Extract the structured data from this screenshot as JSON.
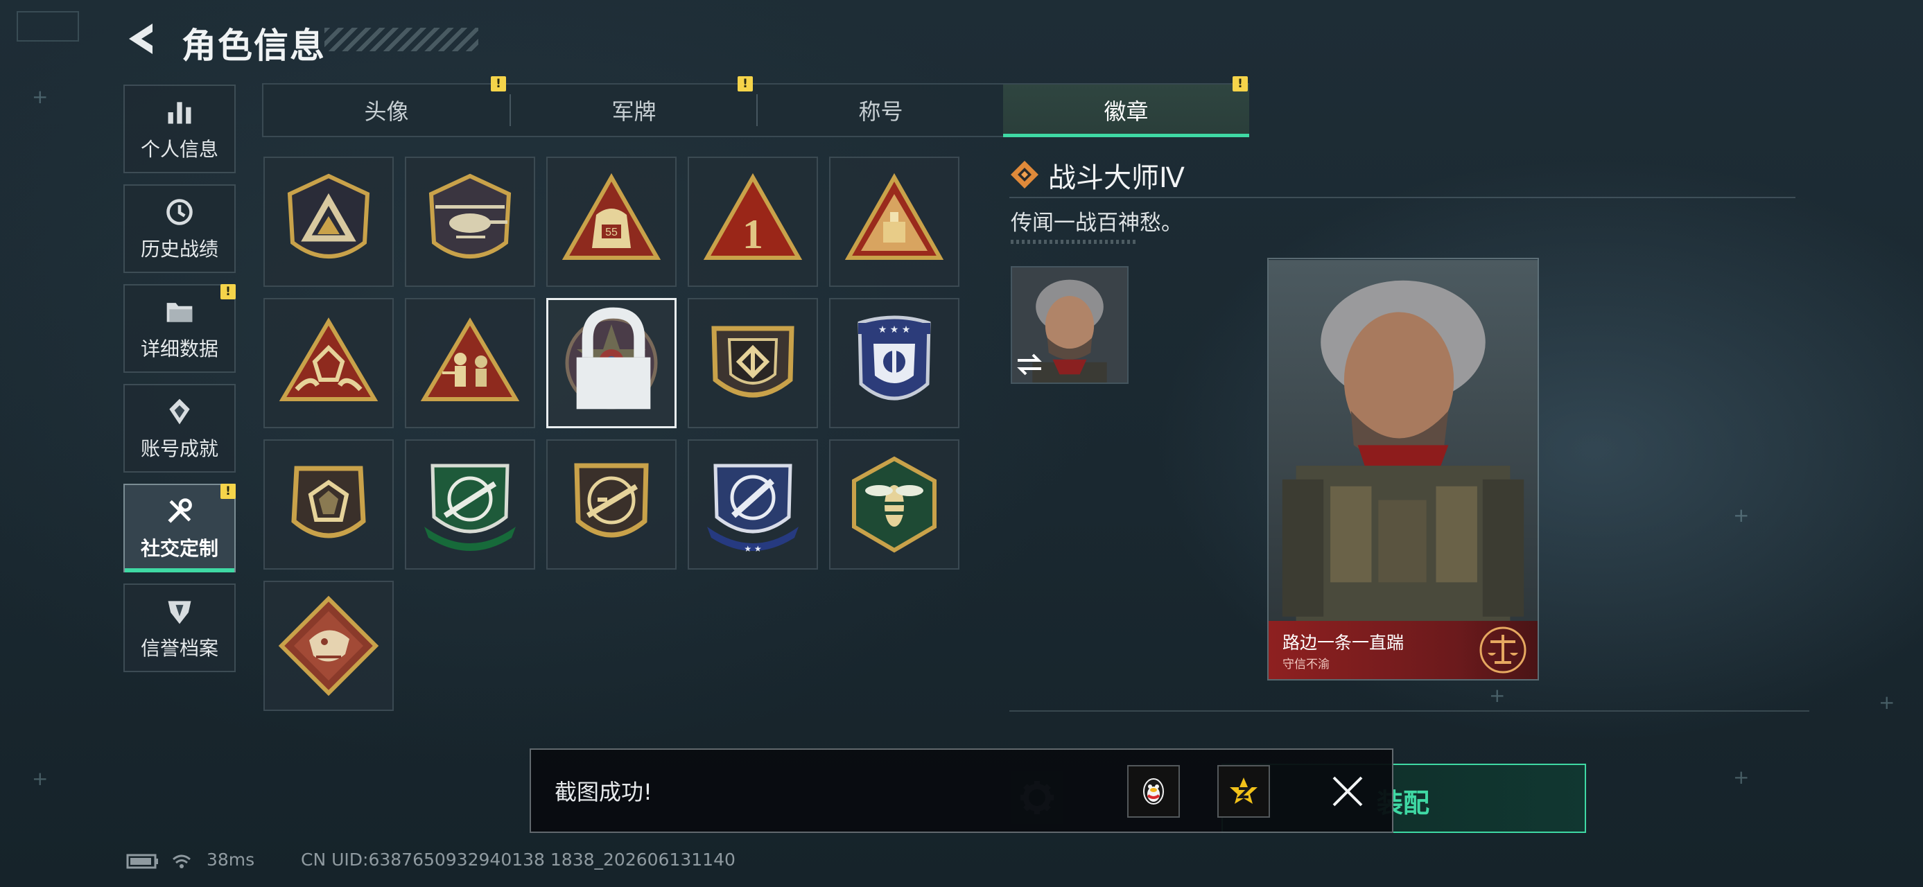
{
  "header": {
    "title": "角色信息"
  },
  "nav": {
    "items": [
      {
        "label": "个人信息",
        "icon": "bar-chart-icon"
      },
      {
        "label": "历史战绩",
        "icon": "history-clock-icon"
      },
      {
        "label": "详细数据",
        "icon": "folder-icon",
        "alert": "!"
      },
      {
        "label": "账号成就",
        "icon": "achievement-icon"
      },
      {
        "label": "社交定制",
        "icon": "wrench-screwdriver-icon",
        "alert": "!",
        "active": true
      },
      {
        "label": "信誉档案",
        "icon": "reputation-shield-icon"
      }
    ]
  },
  "tabs": [
    {
      "label": "头像",
      "alert": "!"
    },
    {
      "label": "军牌",
      "alert": "!"
    },
    {
      "label": "称号"
    },
    {
      "label": "徽章",
      "alert": "!",
      "active": true
    }
  ],
  "badges": [
    {
      "name": "triangle-shield-badge"
    },
    {
      "name": "helicopter-badge"
    },
    {
      "name": "bag-55-badge",
      "text": "55"
    },
    {
      "name": "number-one-badge",
      "text": "1"
    },
    {
      "name": "bar-triangle-badge"
    },
    {
      "name": "hands-gem-badge"
    },
    {
      "name": "soldiers-badge"
    },
    {
      "name": "star-emblem-badge",
      "selected": true,
      "locked": true
    },
    {
      "name": "arrow-shield-badge"
    },
    {
      "name": "blue-stars-shield-badge"
    },
    {
      "name": "gem-hexagon-badge"
    },
    {
      "name": "green-rifle-crest-badge"
    },
    {
      "name": "rifle-circle-badge"
    },
    {
      "name": "blue-knife-crest-badge"
    },
    {
      "name": "wasp-hexagon-badge"
    },
    {
      "name": "dragon-diamond-badge"
    }
  ],
  "detail": {
    "title": "战斗大师Ⅳ",
    "description": "传闻一战百神愁。"
  },
  "card": {
    "name": "路边一条一直踹",
    "subtitle": "守信不渝"
  },
  "equip": {
    "label": "装配"
  },
  "toast": {
    "message": "截图成功!"
  },
  "status": {
    "ping": "38ms",
    "uid": "CN UID:6387650932940138 1838_202606131140"
  },
  "colors": {
    "accent": "#3fd9a4",
    "alert": "#f5d44a",
    "card_red": "#8e2020",
    "gold": "#c9a24a"
  }
}
